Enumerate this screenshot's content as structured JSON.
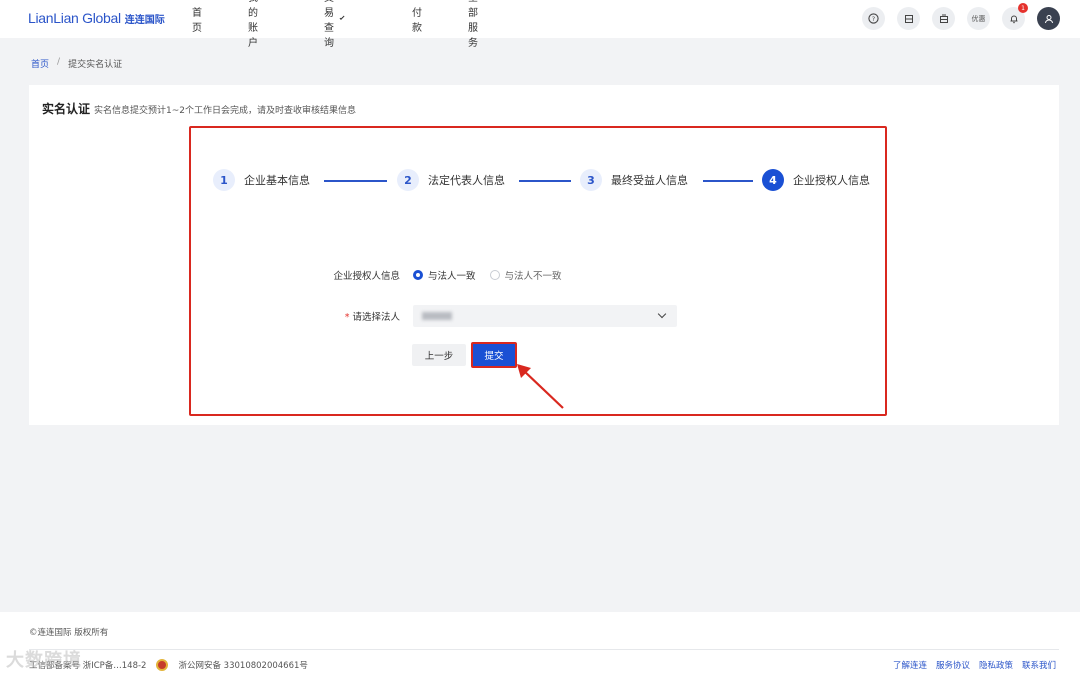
{
  "header": {
    "logo_en": "LianLian Global",
    "logo_cn": "连连国际",
    "nav": [
      "首页",
      "我的账户",
      "交易查询",
      "付款",
      "全部服务"
    ],
    "icons": [
      "help-icon",
      "document-icon",
      "wallet-icon",
      "coupon-icon",
      "bell-icon",
      "user-icon"
    ],
    "coupon_label": "优惠",
    "notification_count": "1"
  },
  "breadcrumb": {
    "home": "首页",
    "separator": "/",
    "current": "提交实名认证"
  },
  "card": {
    "title": "实名认证",
    "subtitle": "实名信息提交预计1~2个工作日会完成，请及时查收审核结果信息"
  },
  "steps": [
    {
      "num": "1",
      "label": "企业基本信息"
    },
    {
      "num": "2",
      "label": "法定代表人信息"
    },
    {
      "num": "3",
      "label": "最终受益人信息"
    },
    {
      "num": "4",
      "label": "企业授权人信息"
    }
  ],
  "active_step": 4,
  "form": {
    "authorizer_label": "企业授权人信息",
    "radio_same": "与法人一致",
    "radio_diff": "与法人不一致",
    "selected_radio": "与法人一致",
    "required_mark": "*",
    "select_label": "请选择法人",
    "prev_button": "上一步",
    "submit_button": "提交"
  },
  "footer": {
    "copyright": "©连连国际 版权所有",
    "icp": "工信部备案号 浙ICP备…148-2",
    "police_record": "浙公网安备 33010802004661号",
    "links": [
      "了解连连",
      "服务协议",
      "隐私政策",
      "联系我们"
    ]
  },
  "watermark": "大数跨境",
  "colors": {
    "brand_blue": "#1a50d4",
    "highlight_red": "#d9281f"
  }
}
